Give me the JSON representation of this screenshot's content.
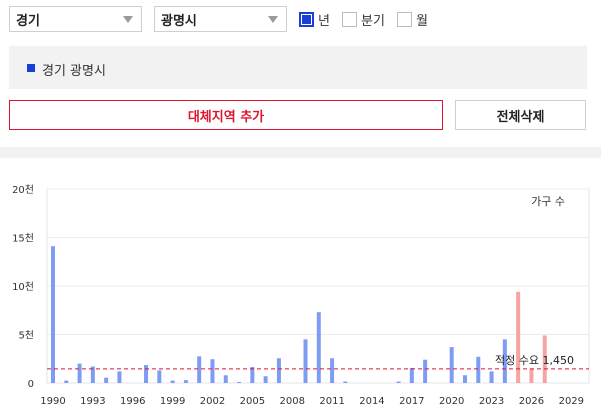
{
  "filters": {
    "region_select": "경기",
    "city_select": "광명시"
  },
  "period": {
    "options": [
      {
        "label": "년",
        "checked": true
      },
      {
        "label": "분기",
        "checked": false
      },
      {
        "label": "월",
        "checked": false
      }
    ]
  },
  "selected_region": {
    "label": "경기 광명시",
    "color": "#1a3fd6"
  },
  "buttons": {
    "add_region": "대체지역 추가",
    "delete_all": "전체삭제"
  },
  "chart_data": {
    "type": "bar",
    "legend": "가구 수",
    "x_ticks": [
      "1990",
      "1993",
      "1996",
      "1999",
      "2002",
      "2005",
      "2008",
      "2011",
      "2014",
      "2017",
      "2020",
      "2023",
      "2026",
      "2029"
    ],
    "y_ticks": [
      "0",
      "5천",
      "10천",
      "15천",
      "20천"
    ],
    "ylim": [
      0,
      20000
    ],
    "xlim": [
      1990,
      2029
    ],
    "grid": true,
    "series": [
      {
        "name": "",
        "color": "#7f9cf5",
        "points": [
          {
            "year": 1990,
            "value": 14100
          },
          {
            "year": 1991,
            "value": 250
          },
          {
            "year": 1992,
            "value": 2000
          },
          {
            "year": 1993,
            "value": 1700
          },
          {
            "year": 1994,
            "value": 550
          },
          {
            "year": 1995,
            "value": 1200
          },
          {
            "year": 1997,
            "value": 1850
          },
          {
            "year": 1998,
            "value": 1300
          },
          {
            "year": 1999,
            "value": 250
          },
          {
            "year": 2000,
            "value": 300
          },
          {
            "year": 2001,
            "value": 2750
          },
          {
            "year": 2002,
            "value": 2450
          },
          {
            "year": 2003,
            "value": 800
          },
          {
            "year": 2004,
            "value": 100
          },
          {
            "year": 2005,
            "value": 1650
          },
          {
            "year": 2006,
            "value": 700
          },
          {
            "year": 2007,
            "value": 2550
          },
          {
            "year": 2009,
            "value": 4500
          },
          {
            "year": 2010,
            "value": 7300
          },
          {
            "year": 2011,
            "value": 2550
          },
          {
            "year": 2012,
            "value": 150
          },
          {
            "year": 2016,
            "value": 150
          },
          {
            "year": 2017,
            "value": 1550
          },
          {
            "year": 2018,
            "value": 2400
          },
          {
            "year": 2020,
            "value": 3700
          },
          {
            "year": 2021,
            "value": 800
          },
          {
            "year": 2022,
            "value": 2700
          },
          {
            "year": 2023,
            "value": 1200
          },
          {
            "year": 2024,
            "value": 4500
          }
        ]
      },
      {
        "name": "",
        "color": "#f5a3a3",
        "points": [
          {
            "year": 2025,
            "value": 9400
          },
          {
            "year": 2026,
            "value": 1500
          },
          {
            "year": 2027,
            "value": 4900
          }
        ]
      }
    ],
    "reference_line": {
      "label": "적정 수요 1,450",
      "value": 1450,
      "color": "#e0142d"
    }
  }
}
